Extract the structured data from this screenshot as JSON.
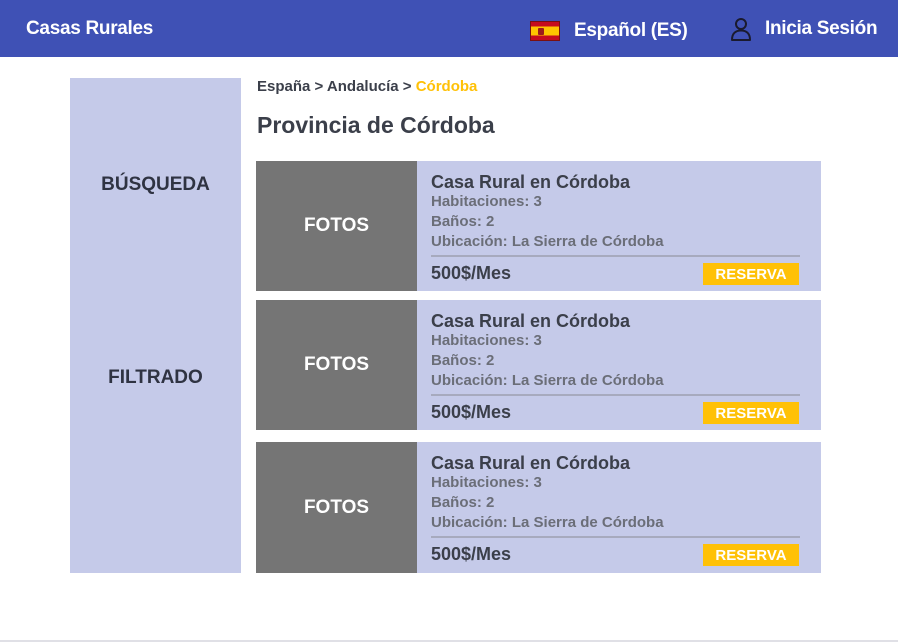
{
  "header": {
    "brand": "Casas Rurales",
    "language": "Español (ES)",
    "login": "Inicia Sesión",
    "color": "#3f51b5"
  },
  "sidebar": {
    "search": "BÚSQUEDA",
    "filter": "FILTRADO"
  },
  "breadcrumb": {
    "items": [
      "España",
      "Andalucía",
      "Córdoba"
    ],
    "separator": ">"
  },
  "page_title": "Provincia de Córdoba",
  "listings": [
    {
      "photo_label": "FOTOS",
      "title": "Casa Rural en Córdoba",
      "rooms": "Habitaciones: 3",
      "baths": "Baños: 2",
      "location": "Ubicación: La Sierra de Córdoba",
      "price": "500$/Mes",
      "reserve": "RESERVA"
    },
    {
      "photo_label": "FOTOS",
      "title": "Casa Rural en Córdoba",
      "rooms": "Habitaciones: 3",
      "baths": "Baños: 2",
      "location": "Ubicación: La Sierra de Córdoba",
      "price": "500$/Mes",
      "reserve": "RESERVA"
    },
    {
      "photo_label": "FOTOS",
      "title": "Casa Rural en Córdoba",
      "rooms": "Habitaciones: 3",
      "baths": "Baños: 2",
      "location": "Ubicación: La Sierra de Córdoba",
      "price": "500$/Mes",
      "reserve": "RESERVA"
    }
  ],
  "icons": {
    "flag": "spain-flag-icon",
    "user": "user-icon"
  },
  "colors": {
    "accent": "#ffc107",
    "panel": "#c5cae9",
    "photo": "#757575"
  }
}
